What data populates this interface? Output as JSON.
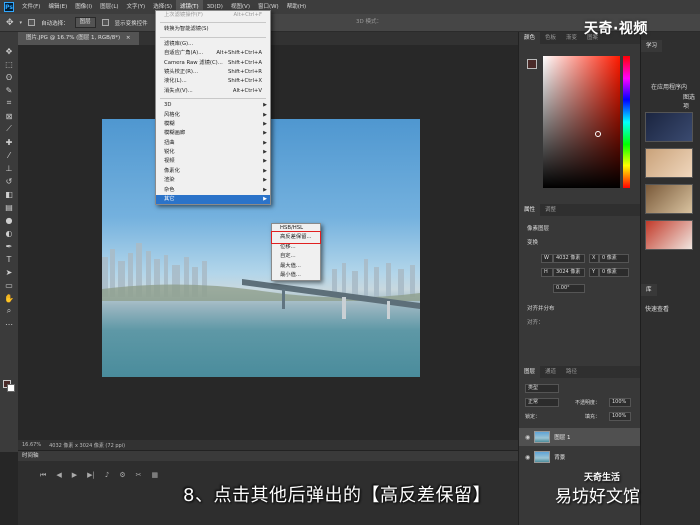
{
  "app": {
    "logo": "Ps"
  },
  "menubar": [
    "文件(F)",
    "编辑(E)",
    "图像(I)",
    "图层(L)",
    "文字(Y)",
    "选择(S)",
    "滤镜(T)",
    "3D(D)",
    "视图(V)",
    "窗口(W)",
    "帮助(H)"
  ],
  "optionsbar": {
    "auto_select_label": "自动选择：",
    "auto_select_value": "图层",
    "show_transform_label": "显示变换控件",
    "mode_3d": "3D 模式："
  },
  "document": {
    "tab_title": "图片.JPG @ 16.7% (图层 1, RGB/8*)",
    "close": "×"
  },
  "status": {
    "zoom": "16.67%",
    "dimensions": "4032 像素 x 3024 像素 (72 ppi)"
  },
  "timeline": {
    "label": "时间轴"
  },
  "filter_menu": {
    "items": [
      {
        "label": "上次滤镜操作(F)",
        "shortcut": "Alt+Ctrl+F",
        "disabled": true
      },
      {
        "sep": true
      },
      {
        "label": "转换为智能滤镜(S)"
      },
      {
        "sep": true
      },
      {
        "label": "滤镜库(G)..."
      },
      {
        "label": "自适应广角(A)...",
        "shortcut": "Alt+Shift+Ctrl+A"
      },
      {
        "label": "Camera Raw 滤镜(C)...",
        "shortcut": "Shift+Ctrl+A"
      },
      {
        "label": "镜头校正(R)...",
        "shortcut": "Shift+Ctrl+R"
      },
      {
        "label": "液化(L)...",
        "shortcut": "Shift+Ctrl+X"
      },
      {
        "label": "消失点(V)...",
        "shortcut": "Alt+Ctrl+V"
      },
      {
        "sep": true
      },
      {
        "label": "3D",
        "submenu": true
      },
      {
        "label": "风格化",
        "submenu": true
      },
      {
        "label": "模糊",
        "submenu": true
      },
      {
        "label": "模糊画廊",
        "submenu": true
      },
      {
        "label": "扭曲",
        "submenu": true
      },
      {
        "label": "锐化",
        "submenu": true
      },
      {
        "label": "视频",
        "submenu": true
      },
      {
        "label": "像素化",
        "submenu": true
      },
      {
        "label": "渲染",
        "submenu": true
      },
      {
        "label": "杂色",
        "submenu": true
      },
      {
        "label": "其它",
        "submenu": true,
        "highlighted": true
      }
    ]
  },
  "other_submenu": {
    "items": [
      {
        "label": "HSB/HSL"
      },
      {
        "label": "高反差保留..."
      },
      {
        "label": "位移..."
      },
      {
        "label": "自定..."
      },
      {
        "label": "最大值..."
      },
      {
        "label": "最小值..."
      }
    ]
  },
  "color_panel": {
    "tabs": [
      "颜色",
      "色板",
      "渐变",
      "图案"
    ],
    "fg_color": "#4a2a28"
  },
  "properties_panel": {
    "tabs": [
      "属性",
      "调整"
    ],
    "layer_type": "像素图层",
    "transform_label": "变换",
    "w_label": "W",
    "w_value": "4032 像素",
    "x_label": "X",
    "x_value": "0 像素",
    "h_label": "H",
    "h_value": "3024 像素",
    "y_label": "Y",
    "y_value": "0 像素",
    "angle": "0.00°",
    "align_label": "对齐并分布",
    "align_sub": "对齐："
  },
  "layers_panel": {
    "tabs": [
      "图层",
      "通道",
      "路径"
    ],
    "kind": "类型",
    "blend": "正常",
    "opacity_label": "不透明度：",
    "opacity": "100%",
    "lock_label": "锁定：",
    "fill_label": "填充：",
    "fill": "100%",
    "layers": [
      {
        "name": "图层 1",
        "selected": true
      },
      {
        "name": "背景",
        "selected": false
      }
    ]
  },
  "learn_panel": {
    "tab": "学习",
    "line1": "在应用程序内",
    "line2": "图选项",
    "lib_tab": "库",
    "lib_item": "快速查看"
  },
  "overlay": {
    "watermark_top": "天奇·视频",
    "caption": "8、点击其他后弹出的【高反差保留】",
    "watermark_small": "天奇生活",
    "watermark_bottom": "易坊好文馆"
  }
}
